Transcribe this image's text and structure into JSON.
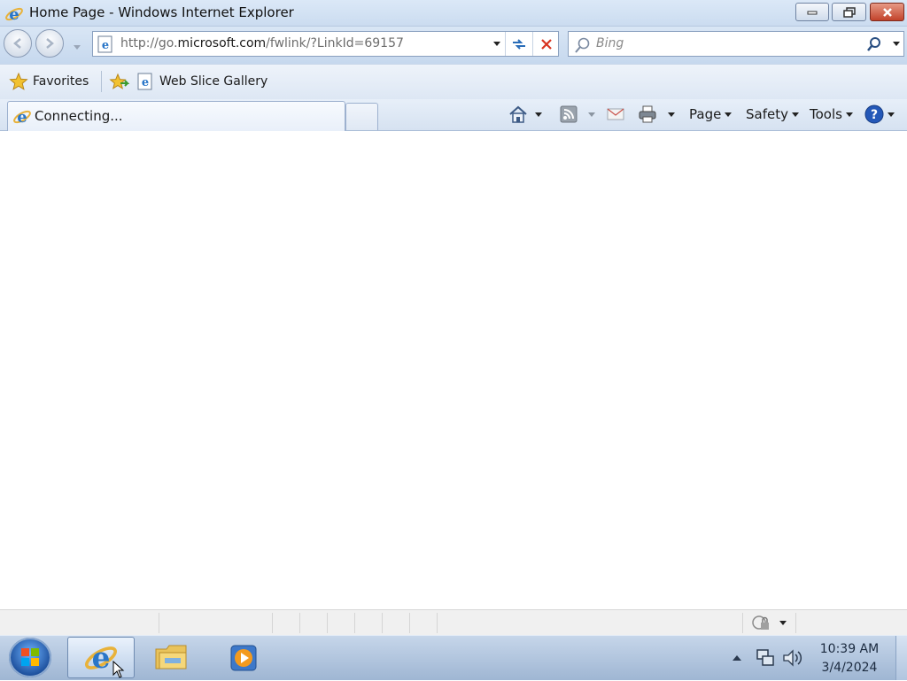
{
  "window": {
    "title": "Home Page - Windows Internet Explorer"
  },
  "navigation": {
    "url_gray_prefix": "http://go.",
    "url_domain": "microsoft.com",
    "url_gray_suffix": "/fwlink/?LinkId=69157",
    "search_placeholder": "Bing"
  },
  "favorites_bar": {
    "favorites_label": "Favorites",
    "items": [
      {
        "label": "Web Slice Gallery",
        "icon": "ie-page-icon"
      }
    ]
  },
  "tabs": [
    {
      "label": "Connecting...",
      "active": true
    }
  ],
  "command_bar": {
    "page_label": "Page",
    "safety_label": "Safety",
    "tools_label": "Tools"
  },
  "taskbar": {
    "time": "10:39 AM",
    "date": "3/4/2024",
    "pinned": [
      "internet-explorer-icon",
      "windows-explorer-icon",
      "media-player-icon"
    ]
  },
  "colors": {
    "chrome_blue": "#cbdcf0",
    "close_red": "#c2432b",
    "taskbar": "#9fb6d3"
  }
}
